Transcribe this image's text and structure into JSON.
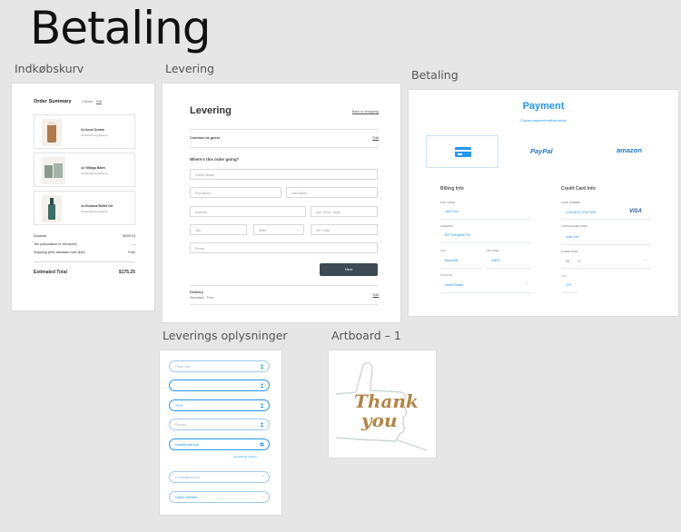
{
  "page_title": "Betaling",
  "boards": {
    "order": {
      "label": "Indkøbskurv",
      "title": "Order Summary",
      "count": "3 items",
      "edit": "Edit",
      "items": [
        {
          "name": "1x Acne Cream",
          "sub": "All Natural Ingredients"
        },
        {
          "name": "1x Vitiligo Balm",
          "sub": "All Natural Ingredients"
        },
        {
          "name": "2x Eczema Relief Oil",
          "sub": "All Natural Ingredients"
        }
      ],
      "subtotal_label": "Subtotal",
      "subtotal_value": "$159.15",
      "tax_label": "Tax (calculation in checkout)",
      "tax_value": "—",
      "shipping_label": "Shipping (free standard over $40)",
      "shipping_value": "Free",
      "total_label": "Estimated Total",
      "total_value": "$175.25"
    },
    "delivery": {
      "label": "Levering",
      "title": "Levering",
      "back": "Back to shopping",
      "guest": "Continue as guest",
      "guest_edit": "Edit",
      "question": "Where's this order going?",
      "fields": {
        "country": "United States",
        "first_name": "First Name",
        "last_name": "Last Name",
        "address": "Address",
        "apt": "Apt / Floor / Suite",
        "city": "City",
        "state": "State",
        "zip": "ZIP Code",
        "phone": "Phone"
      },
      "next": "Next",
      "delivery_title": "Delivery",
      "delivery_sub": "Standard - Free",
      "delivery_edit": "Edit"
    },
    "payment": {
      "label": "Betaling",
      "title": "Payment",
      "subtitle": "Choose payment method below",
      "paypal": "PayPal",
      "amazon": "amazon",
      "billing_title": "Billing Info",
      "full_name_label": "FULL NAME",
      "full_name": "John Doe",
      "address_label": "ADDRESS",
      "address": "897 Evergreen Rd",
      "city_label": "CITY",
      "city": "Brazzville",
      "zip_label": "ZIP CODE",
      "zip": "94873",
      "country_label": "COUNTRY",
      "country": "United States",
      "card_title": "Credit Card Info",
      "card_number_label": "CARD NUMBER",
      "card_number": "1234  5678  1234  1409",
      "card_brand": "VISA",
      "cardholder_label": "CARDHOLDER NAME",
      "cardholder": "John Doe",
      "expiry_label": "EXPIRE DATE",
      "expiry_month": "05",
      "expiry_year": "17",
      "cvv_label": "CVV",
      "cvv": "123"
    },
    "info": {
      "label": "Leverings oplysninger",
      "fields": [
        "Fulde navn",
        "",
        "Tlf.nr",
        "Firmanr",
        "email@mail.com"
      ],
      "hint": "Something's missing",
      "select1": "Leveringsmetode",
      "select2": "Option selected"
    },
    "thanks": {
      "label": "Artboard – 1",
      "line1": "Thank",
      "line2": "you"
    }
  },
  "colors": {
    "accent": "#2196f3",
    "button_dark": "#3d4a54",
    "thank_you": "#b38545"
  }
}
